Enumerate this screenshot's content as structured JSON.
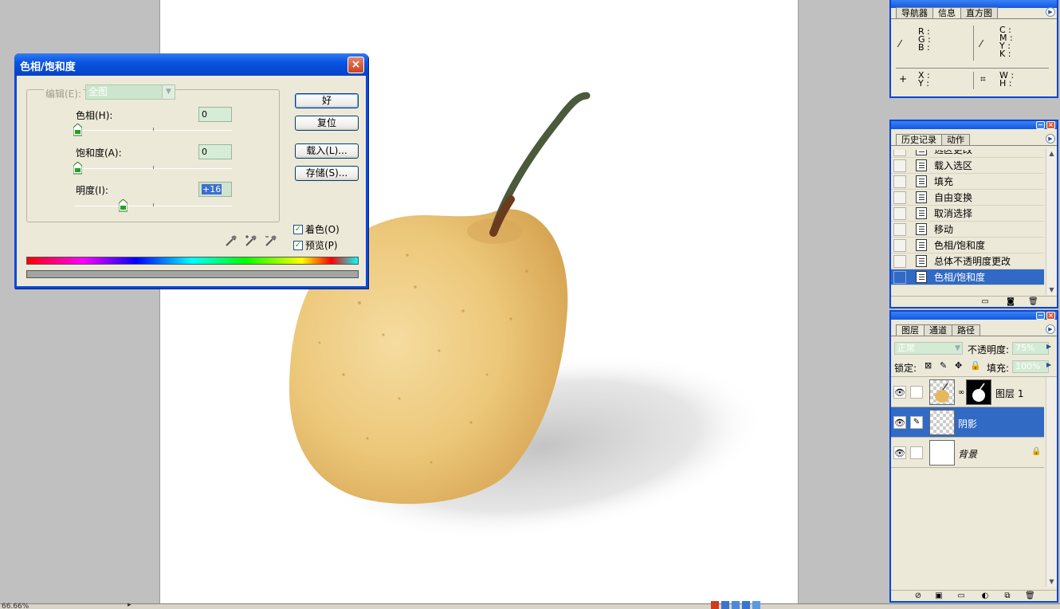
{
  "dialog": {
    "title": "色相/饱和度",
    "close": "×",
    "edit_label": "编辑(E):",
    "edit_value": "全图",
    "hue": {
      "label": "色相(H):",
      "value": "0",
      "level": 0
    },
    "saturation": {
      "label": "饱和度(A):",
      "value": "0",
      "level": 0
    },
    "lightness": {
      "label": "明度(I):",
      "value": "+16",
      "level": 58
    },
    "buttons": {
      "ok": "好",
      "reset": "复位",
      "load": "载入(L)...",
      "save": "存储(S)..."
    },
    "colorize": {
      "label": "着色(O)",
      "checked": true
    },
    "preview": {
      "label": "预览(P)",
      "checked": true
    },
    "checkmark": "✓"
  },
  "info_panel": {
    "tabs": [
      "导航器",
      "信息",
      "直方图"
    ],
    "active_tab": 1,
    "rgb": [
      "R :",
      "G :",
      "B :"
    ],
    "cmyk": [
      "C :",
      "M :",
      "Y :",
      "K :"
    ],
    "xy": [
      "X :",
      "Y :"
    ],
    "wh": [
      "W :",
      "H :"
    ]
  },
  "history_panel": {
    "tabs": [
      "历史记录",
      "动作"
    ],
    "items": [
      "选区更改",
      "载入选区",
      "填充",
      "自由变换",
      "取消选择",
      "移动",
      "色相/饱和度",
      "总体不透明度更改",
      "色相/饱和度"
    ],
    "selected_index": 8
  },
  "layers_panel": {
    "tabs": [
      "图层",
      "通道",
      "路径"
    ],
    "blend_mode": "正常",
    "opacity_label": "不透明度:",
    "opacity_value": "75%",
    "lock_label": "锁定:",
    "fill_label": "填充:",
    "fill_value": "100%",
    "layers": [
      {
        "name": "图层 1",
        "selected": false
      },
      {
        "name": "阴影",
        "selected": true
      },
      {
        "name": "背景",
        "selected": false
      }
    ]
  },
  "status": {
    "zoom": "66.66%"
  },
  "colors": {
    "title_blue": "#0a55e0",
    "selection": "#316ac5",
    "pear": "#e9c070"
  }
}
